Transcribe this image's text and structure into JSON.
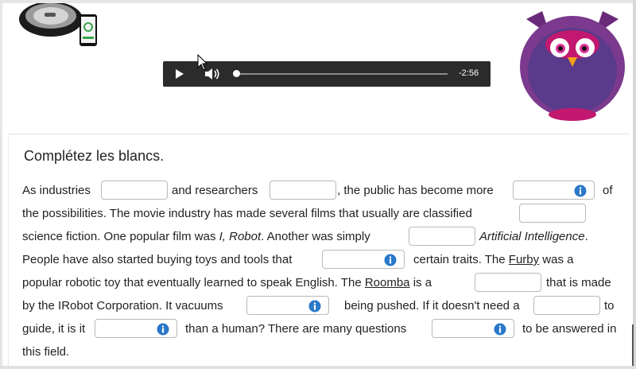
{
  "audio": {
    "time_remaining": "-2:56",
    "progress": 0
  },
  "instructions": "Complétez les blancs.",
  "lines": {
    "l1a": "As industries",
    "l1b": "and researchers",
    "l1c": ", the public has become more",
    "l1d": "of",
    "l2a": "the possibilities. The movie industry has made several films that usually are classified",
    "l3a": "science fiction. One popular film was ",
    "l3b": "I, Robot",
    "l3c": ". Another was simply",
    "l3d": "Artificial Intelligence",
    "l3e": ".",
    "l4a": "People have also started buying toys and tools that",
    "l4b": "certain traits. The ",
    "l4c": "Furby",
    "l4d": " was a",
    "l5a": "popular robotic toy that eventually learned to speak English. The ",
    "l5b": "Roomba",
    "l5c": " is a",
    "l5d": "that is made",
    "l6a": "by the IRobot Corporation. It vacuums",
    "l6b": "being pushed. If it doesn't need a",
    "l6c": "to",
    "l7a": "guide, it is it",
    "l7b": "than a human? There are many questions",
    "l7c": "to be answered in",
    "l8a": "this field."
  },
  "colors": {
    "info_icon": "#2a78c8",
    "player_bg": "#2b2b2b"
  }
}
